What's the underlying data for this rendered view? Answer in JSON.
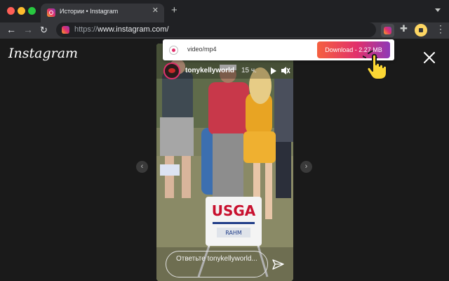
{
  "browser": {
    "tab_title": "Истории • Instagram",
    "tab_close": "✕",
    "new_tab": "+",
    "url_scheme": "https://",
    "url_host": "www.instagram.com/",
    "back": "←",
    "forward": "→",
    "reload": "↻",
    "puzzle": "✚",
    "kebab": "⋮"
  },
  "page": {
    "logo": "Instagram",
    "prev_arrow": "‹",
    "next_arrow": "›"
  },
  "story": {
    "username": "tonykellyworld",
    "time_ago": "15 ч.",
    "more": "•••",
    "reply_placeholder": "Ответьте tonykellyworld...",
    "sign_brand": "USGA",
    "sign_name": "RAHM"
  },
  "download_popup": {
    "file_type": "video/mp4",
    "button_label": "Download - 2.27 MB"
  },
  "icons": {
    "favicon": "instagram-icon",
    "extension": "downloader-extension-icon",
    "cursor": "hand-pointer-icon"
  },
  "colors": {
    "instagram_gradient_start": "#f56040",
    "instagram_gradient_mid": "#e1306c",
    "instagram_gradient_end": "#8e3ab7",
    "page_bg": "#1a1a1a"
  }
}
